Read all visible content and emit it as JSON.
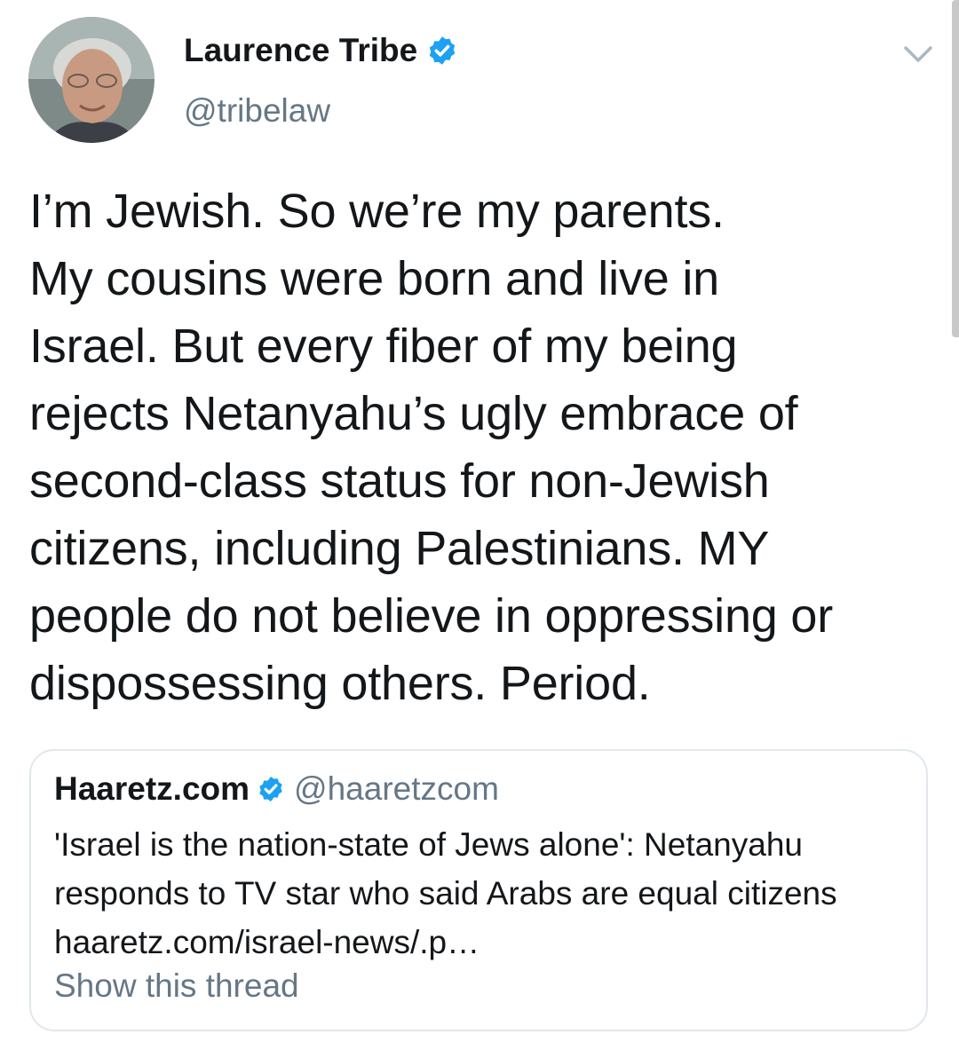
{
  "tweet": {
    "author": {
      "display_name": "Laurence Tribe",
      "handle": "@tribelaw",
      "verified": true
    },
    "text": "I’m Jewish. So we’re my parents.\nMy cousins were born and live in\nIsrael. But every fiber of my being\nrejects Netanyahu’s ugly embrace of\nsecond-class status for non-Jewish\ncitizens, including Palestinians. MY\npeople do not believe in oppressing or\ndispossessing others. Period."
  },
  "quoted_tweet": {
    "display_name": "Haaretz.com",
    "handle": "@haaretzcom",
    "verified": true,
    "text": "'Israel is the nation-state of Jews alone': Netanyahu responds to TV star who said Arabs are equal citizens haaretz.com/israel-news/.p…",
    "show_thread_label": "Show this thread"
  },
  "icons": {
    "verified": "verified-badge-icon",
    "menu": "chevron-down-icon"
  },
  "colors": {
    "verified_blue": "#1da1f2",
    "secondary_text": "#657786",
    "primary_text": "#14171a",
    "border": "#e1e8ed"
  }
}
